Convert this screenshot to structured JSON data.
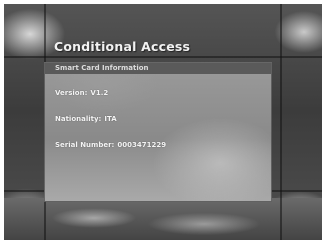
{
  "window": {
    "title": "Conditional Access"
  },
  "panel": {
    "header": "Smart Card Information",
    "rows": [
      {
        "label": "Version:",
        "value": "V1.2"
      },
      {
        "label": "Nationality:",
        "value": "ITA"
      },
      {
        "label": "Serial Number:",
        "value": "0003471229"
      }
    ]
  }
}
